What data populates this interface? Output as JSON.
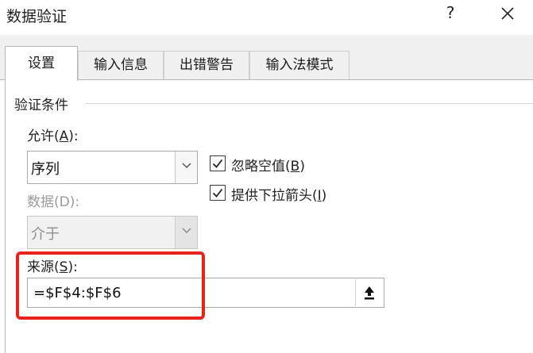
{
  "dialog": {
    "title": "数据验证",
    "help": "?",
    "close_icon": "close-icon"
  },
  "tabs": [
    {
      "label": "设置",
      "active": true
    },
    {
      "label": "输入信息",
      "active": false
    },
    {
      "label": "出错警告",
      "active": false
    },
    {
      "label": "输入法模式",
      "active": false
    }
  ],
  "settings": {
    "group_label": "验证条件",
    "allow": {
      "label_prefix": "允许(",
      "label_key": "A",
      "label_suffix": "):",
      "value": "序列"
    },
    "data": {
      "label": "数据(D):",
      "value": "介于",
      "disabled": true
    },
    "ignore_blank": {
      "label_prefix": "忽略空值(",
      "label_key": "B",
      "label_suffix": ")",
      "checked": true
    },
    "in_cell_dropdown": {
      "label_prefix": "提供下拉箭头(",
      "label_key": "I",
      "label_suffix": ")",
      "checked": true
    },
    "source": {
      "label_prefix": "来源(",
      "label_key": "S",
      "label_suffix": "):",
      "value": "=$F$4:$F$6",
      "button_icon": "collapse-dialog-icon"
    }
  },
  "colors": {
    "highlight": "#e8231d",
    "tab_strip": "#f0f0f0",
    "border": "#a9a9a9"
  }
}
